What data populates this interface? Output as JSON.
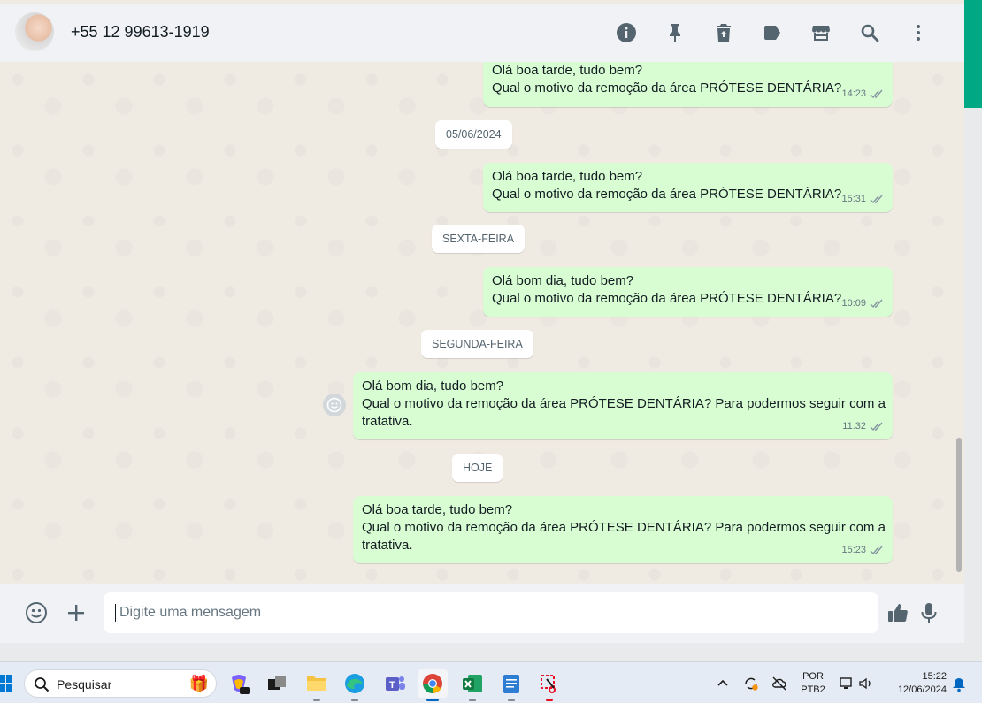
{
  "header": {
    "contact_name": "+55 12 99613-1919",
    "icons": [
      "info-icon",
      "pin-icon",
      "delete-icon",
      "label-icon",
      "store-icon",
      "search-icon",
      "menu-icon"
    ]
  },
  "messages": [
    {
      "lines": [
        "Olá boa tarde, tudo bem?",
        "Qual o motivo da remoção da área PRÓTESE DENTÁRIA?"
      ],
      "time": "14:23",
      "status": "read"
    },
    {
      "lines": [
        "Olá boa tarde, tudo bem?",
        "Qual o motivo da remoção da área PRÓTESE DENTÁRIA?"
      ],
      "time": "15:31",
      "status": "read"
    },
    {
      "lines": [
        "Olá bom dia, tudo bem?",
        "Qual o motivo da remoção da área PRÓTESE DENTÁRIA?"
      ],
      "time": "10:09",
      "status": "read"
    },
    {
      "lines": [
        "Olá bom dia, tudo bem?",
        "Qual o motivo da remoção da área PRÓTESE DENTÁRIA? Para podermos seguir com a",
        "tratativa."
      ],
      "time": "11:32",
      "status": "read"
    },
    {
      "lines": [
        "Olá boa tarde, tudo bem?",
        "Qual o motivo da remoção da área PRÓTESE DENTÁRIA? Para podermos seguir com a",
        "tratativa."
      ],
      "time": "15:23",
      "status": "read"
    }
  ],
  "date_separators": [
    "05/06/2024",
    "SEXTA-FEIRA",
    "SEGUNDA-FEIRA",
    "HOJE"
  ],
  "composer": {
    "placeholder": "Digite uma mensagem"
  },
  "taskbar": {
    "search_placeholder": "Pesquisar",
    "language_line1": "POR",
    "language_line2": "PTB2",
    "time": "15:22",
    "date": "12/06/2024"
  },
  "colors": {
    "accent": "#00a884",
    "outgoing_bubble": "#d9fdd3",
    "chat_background": "#efeae2",
    "header_background": "#f0f2f5"
  }
}
